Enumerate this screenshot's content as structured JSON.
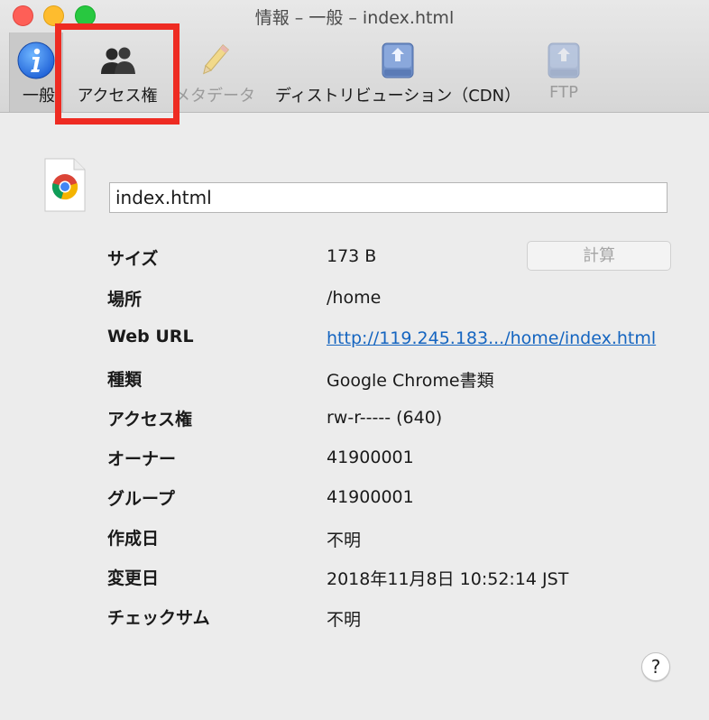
{
  "window": {
    "title": "情報 – 一般 – index.html"
  },
  "toolbar": {
    "tabs": [
      {
        "id": "general",
        "label": "一般",
        "icon": "info-icon",
        "enabled": true,
        "selected": true
      },
      {
        "id": "access",
        "label": "アクセス権",
        "icon": "users-icon",
        "enabled": true,
        "selected": false
      },
      {
        "id": "metadata",
        "label": "メタデータ",
        "icon": "pencil-icon",
        "enabled": false,
        "selected": false
      },
      {
        "id": "cdn",
        "label": "ディストリビューション（CDN）",
        "icon": "server-icon",
        "enabled": true,
        "selected": false
      },
      {
        "id": "ftp",
        "label": "FTP",
        "icon": "server-icon",
        "enabled": false,
        "selected": false
      }
    ]
  },
  "file": {
    "icon": "chrome-document-icon",
    "name": "index.html"
  },
  "info": {
    "rows": [
      {
        "label": "サイズ",
        "value": "173 B"
      },
      {
        "label": "場所",
        "value": "/home"
      },
      {
        "label": "Web URL",
        "value": "http://119.245.183.../home/index.html"
      },
      {
        "label": "種類",
        "value": "Google Chrome書類"
      },
      {
        "label": "アクセス権",
        "value": "rw-r----- (640)"
      },
      {
        "label": "オーナー",
        "value": "41900001"
      },
      {
        "label": "グループ",
        "value": "41900001"
      },
      {
        "label": "作成日",
        "value": "不明"
      },
      {
        "label": "変更日",
        "value": "2018年11月8日 10:52:14 JST"
      },
      {
        "label": "チェックサム",
        "value": "不明"
      }
    ],
    "calculate_label": "計算"
  },
  "help": {
    "label": "?"
  },
  "colors": {
    "highlight": "#ee2b22",
    "link": "#1565c0"
  }
}
